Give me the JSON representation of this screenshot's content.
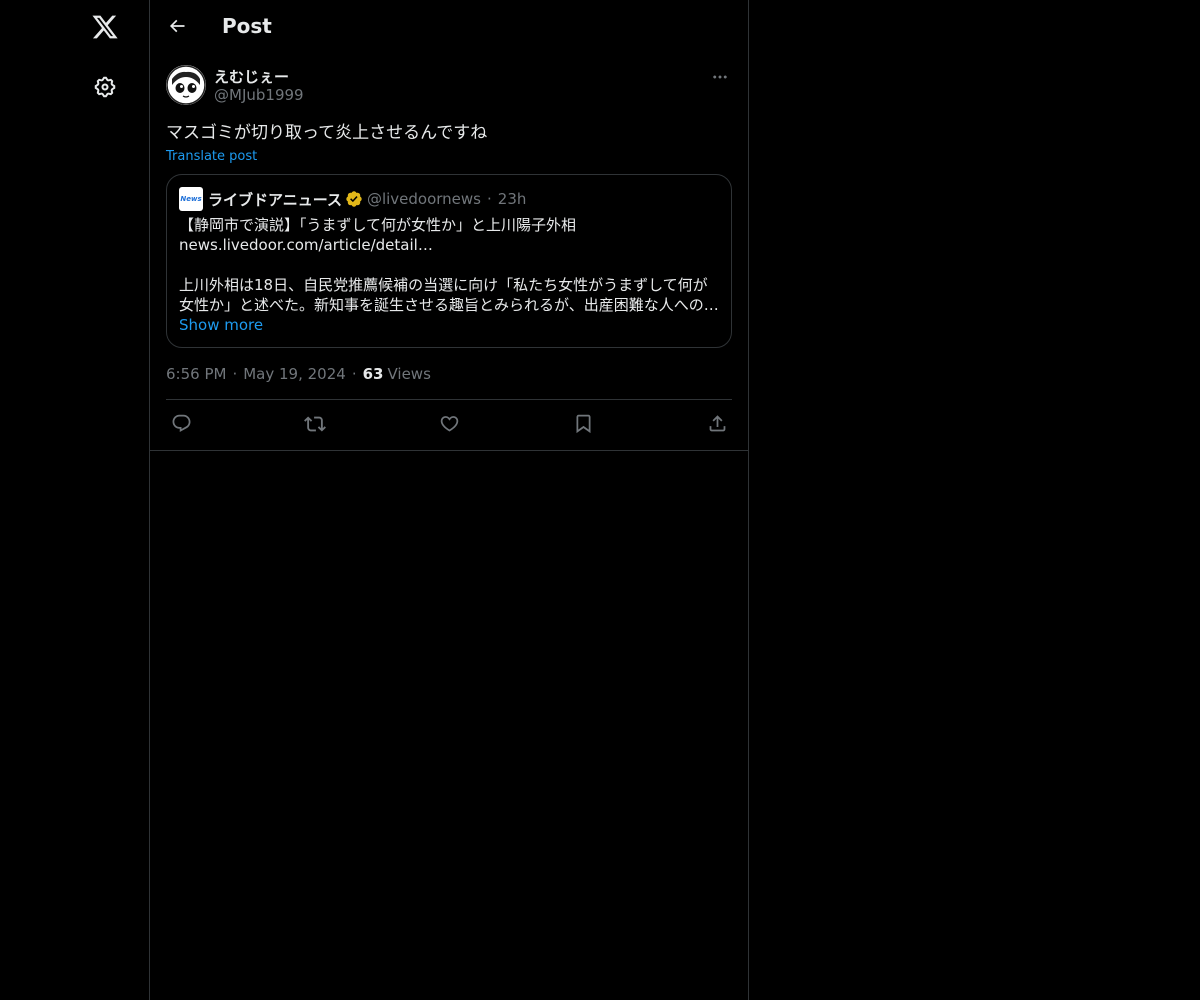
{
  "nav": {
    "logo_icon": "x-logo-icon",
    "settings_icon": "gear-icon"
  },
  "header": {
    "title": "Post",
    "back_icon": "arrow-left-icon"
  },
  "tweet": {
    "author": {
      "display_name": "えむじぇー",
      "handle": "@MJub1999"
    },
    "text": "マスゴミが切り取って炎上させるんですね",
    "translate_label": "Translate post",
    "quote": {
      "logo_text": "News",
      "name": "ライブドアニュース",
      "verified": true,
      "handle": "@livedoornews",
      "time": "23h",
      "lines": [
        "【静岡市で演説】「うまずして何が女性か」と上川陽子外相",
        "news.livedoor.com/article/detail…",
        "",
        "上川外相は18日、自民党推薦候補の当選に向け「私たち女性がうまずして何が",
        "女性か」と述べた。新知事を誕生させる趣旨とみられるが、出産困難な人への…"
      ],
      "show_more": "Show more"
    },
    "meta": {
      "time": "6:56 PM",
      "date": "May 19, 2024",
      "views_count": "63",
      "views_label": "Views"
    },
    "actions": [
      "reply-icon",
      "retweet-icon",
      "like-icon",
      "bookmark-icon",
      "share-icon"
    ]
  },
  "colors": {
    "background": "#000000",
    "text": "#e7e9ea",
    "secondary": "#71767b",
    "link": "#1d9bf0",
    "border": "#2f3336",
    "verified": "#e2b719"
  }
}
